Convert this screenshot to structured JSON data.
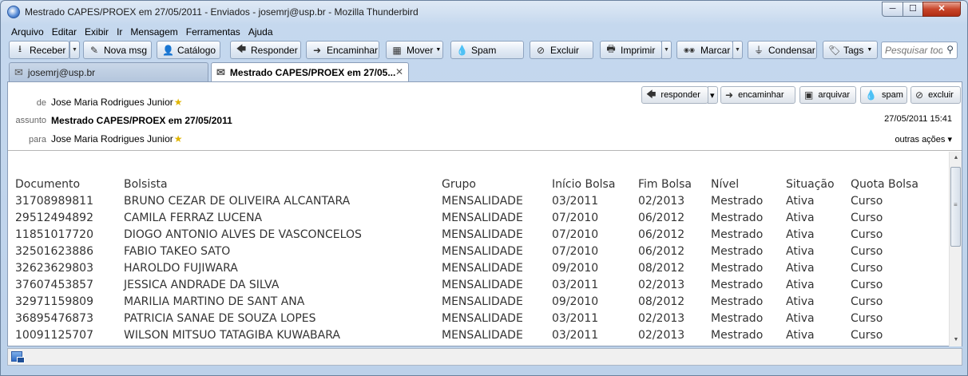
{
  "window": {
    "title": "Mestrado CAPES/PROEX em 27/05/2011 - Enviados - josemrj@usp.br - Mozilla Thunderbird",
    "min_glyph": "─",
    "max_glyph": "☐",
    "close_glyph": "✕"
  },
  "menu": [
    "Arquivo",
    "Editar",
    "Exibir",
    "Ir",
    "Mensagem",
    "Ferramentas",
    "Ajuda"
  ],
  "toolbar": {
    "receber": "Receber",
    "nova_msg": "Nova msg",
    "catalogo": "Catálogo",
    "responder": "Responder",
    "encaminhar": "Encaminhar",
    "mover": "Mover",
    "spam": "Spam",
    "excluir": "Excluir",
    "imprimir": "Imprimir",
    "marcar": "Marcar",
    "condensar": "Condensar",
    "tags": "Tags",
    "search_placeholder": "Pesquisar tod",
    "icons": {
      "receber": "⭳",
      "nova_msg": "✎",
      "catalogo": "👤",
      "responder": "🡄",
      "encaminhar": "➜",
      "mover": "▦",
      "spam": "💧",
      "excluir": "⊘",
      "imprimir": "🖶",
      "marcar": "◉◉",
      "condensar": "⏚",
      "tags": "🏷",
      "search": "⚲",
      "dropdown": "▼"
    }
  },
  "tabs": [
    {
      "label": "josemrj@usp.br",
      "icon": "✉"
    },
    {
      "label": "Mestrado CAPES/PROEX em 27/05...",
      "icon": "✉",
      "close": "✕"
    }
  ],
  "header": {
    "from_label": "de",
    "from": "Jose Maria Rodrigues Junior",
    "subject_label": "assunto",
    "subject": "Mestrado CAPES/PROEX em 27/05/2011",
    "to_label": "para",
    "to": "Jose Maria Rodrigues Junior",
    "star": "★",
    "date": "27/05/2011 15:41",
    "more_actions": "outras ações ▾",
    "buttons": {
      "responder": "responder",
      "encaminhar": "encaminhar",
      "arquivar": "arquivar",
      "spam": "spam",
      "excluir": "excluir"
    },
    "button_icons": {
      "responder": "🡄",
      "encaminhar": "➜",
      "arquivar": "▣",
      "spam": "💧",
      "excluir": "⊘",
      "dropdown": "▾"
    }
  },
  "table": {
    "headers": [
      "Documento",
      "Bolsista",
      "Grupo",
      "Início Bolsa",
      "Fim Bolsa",
      "Nível",
      "Situação",
      "Quota Bolsa"
    ],
    "rows": [
      [
        "31708989811",
        "BRUNO CEZAR DE OLIVEIRA ALCANTARA",
        "MENSALIDADE",
        "03/2011",
        "02/2013",
        "Mestrado",
        "Ativa",
        "Curso"
      ],
      [
        "29512494892",
        "CAMILA FERRAZ LUCENA",
        "MENSALIDADE",
        "07/2010",
        "06/2012",
        "Mestrado",
        "Ativa",
        "Curso"
      ],
      [
        "11851017720",
        "DIOGO ANTONIO ALVES DE VASCONCELOS",
        "MENSALIDADE",
        "07/2010",
        "06/2012",
        "Mestrado",
        "Ativa",
        "Curso"
      ],
      [
        "32501623886",
        "FABIO TAKEO SATO",
        "MENSALIDADE",
        "07/2010",
        "06/2012",
        "Mestrado",
        "Ativa",
        "Curso"
      ],
      [
        "32623629803",
        "HAROLDO FUJIWARA",
        "MENSALIDADE",
        "09/2010",
        "08/2012",
        "Mestrado",
        "Ativa",
        "Curso"
      ],
      [
        "37607453857",
        "JESSICA ANDRADE DA SILVA",
        "MENSALIDADE",
        "03/2011",
        "02/2013",
        "Mestrado",
        "Ativa",
        "Curso"
      ],
      [
        "32971159809",
        "MARILIA MARTINO DE SANT ANA",
        "MENSALIDADE",
        "09/2010",
        "08/2012",
        "Mestrado",
        "Ativa",
        "Curso"
      ],
      [
        "36895476873",
        "PATRICIA SANAE DE SOUZA LOPES",
        "MENSALIDADE",
        "03/2011",
        "02/2013",
        "Mestrado",
        "Ativa",
        "Curso"
      ],
      [
        "10091125707",
        "WILSON MITSUO TATAGIBA KUWABARA",
        "MENSALIDADE",
        "03/2011",
        "02/2013",
        "Mestrado",
        "Ativa",
        "Curso"
      ]
    ]
  },
  "scrollbar": {
    "up": "▲",
    "down": "▼",
    "grip": "≡"
  }
}
